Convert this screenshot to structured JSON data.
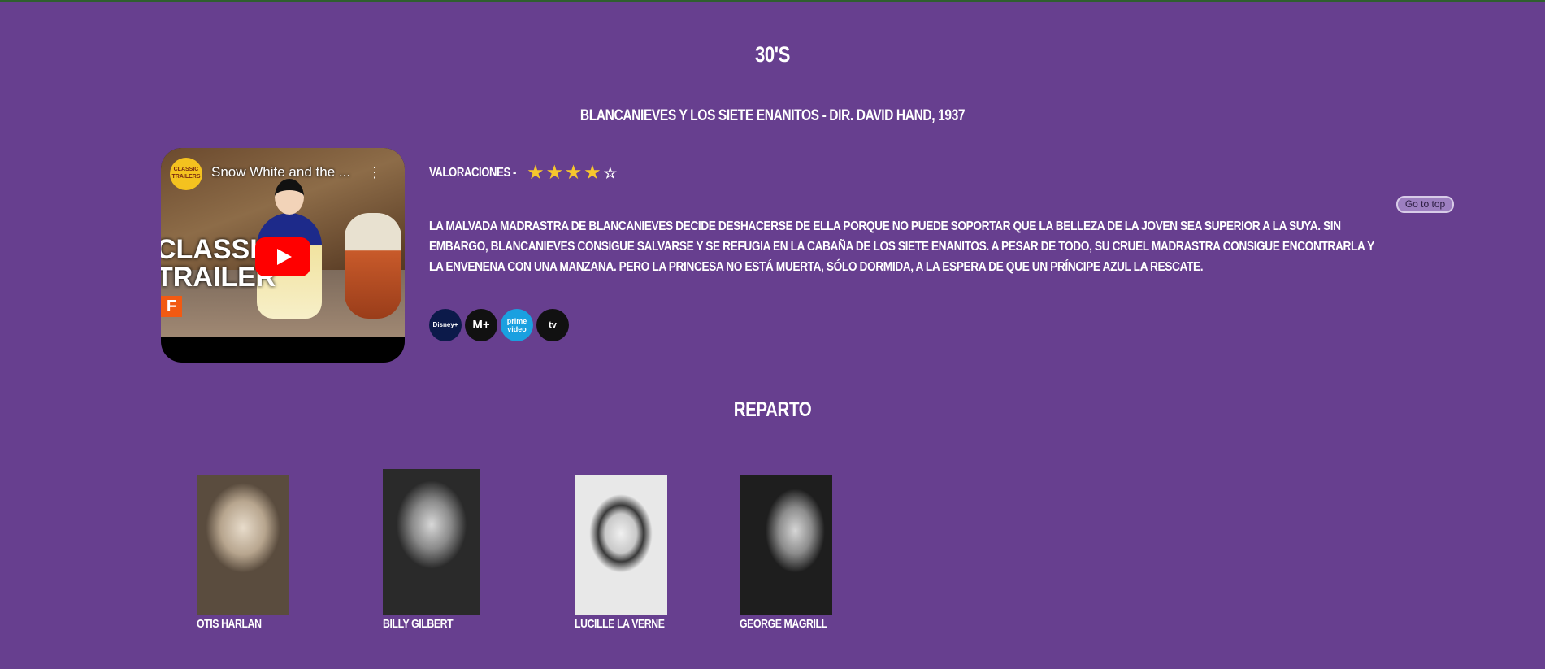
{
  "decade": "30'S",
  "movie": {
    "title": "BLANCANIEVES Y LOS SIETE ENANITOS - DIR. DAVID HAND, 1937",
    "trailer": {
      "video_title": "Snow White and the ...",
      "channel_badge": "CLASSIC TRAILERS",
      "overlay_text": "CLASSIC TRAILER"
    },
    "ratings_label": "VALORACIONES -",
    "rating": {
      "value": 4,
      "max": 5
    },
    "synopsis": "LA MALVADA MADRASTRA DE BLANCANIEVES DECIDE DESHACERSE DE ELLA PORQUE NO PUEDE SOPORTAR QUE LA BELLEZA DE LA JOVEN SEA SUPERIOR A LA SUYA. SIN EMBARGO, BLANCANIEVES CONSIGUE SALVARSE Y SE REFUGIA EN LA CABAÑA DE LOS SIETE ENANITOS. A PESAR DE TODO, SU CRUEL MADRASTRA CONSIGUE ENCONTRARLA Y LA ENVENENA CON UNA MANZANA. PERO LA PRINCESA NO ESTÁ MUERTA, SÓLO DORMIDA, A LA ESPERA DE QUE UN PRÍNCIPE AZUL LA RESCATE.",
    "platforms": [
      {
        "name": "disney-plus-icon",
        "label": "Disney+"
      },
      {
        "name": "movistar-plus-icon",
        "label": "M+"
      },
      {
        "name": "prime-video-icon",
        "label": "prime video"
      },
      {
        "name": "apple-tv-icon",
        "label": "tv"
      }
    ]
  },
  "go_to_top_label": "Go to top",
  "cast_title": "REPARTO",
  "cast": [
    {
      "name": "OTIS HARLAN"
    },
    {
      "name": "BILLY GILBERT"
    },
    {
      "name": "LUCILLE LA VERNE"
    },
    {
      "name": "GEORGE MAGRILL"
    }
  ],
  "colors": {
    "background": "#673f8f",
    "star": "#f7c62d",
    "play_button": "#ff0000"
  }
}
